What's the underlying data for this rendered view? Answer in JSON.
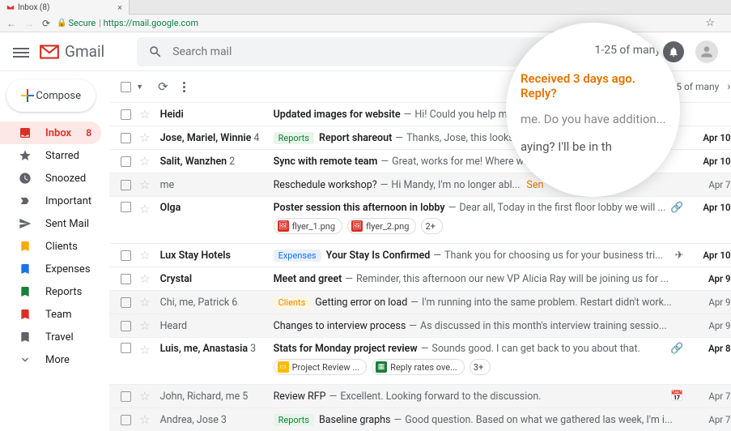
{
  "browser": {
    "tab_title": "Inbox (8)",
    "secure_label": "Secure",
    "url_host": "https://mail.google.com"
  },
  "header": {
    "product": "Gmail",
    "search_placeholder": "Search mail"
  },
  "compose_label": "Compose",
  "sidebar": [
    {
      "label": "Inbox",
      "count": "8"
    },
    {
      "label": "Starred"
    },
    {
      "label": "Snoozed"
    },
    {
      "label": "Important"
    },
    {
      "label": "Sent Mail"
    },
    {
      "label": "Clients"
    },
    {
      "label": "Expenses"
    },
    {
      "label": "Reports"
    },
    {
      "label": "Team"
    },
    {
      "label": "Travel"
    },
    {
      "label": "More"
    }
  ],
  "page_info": "1-25 of many",
  "emails": [
    {
      "sender_html": "Heidi",
      "unread": true,
      "subject": "Updated images for website",
      "snippet": "Hi! Could you help me",
      "date": ""
    },
    {
      "sender_html": "Jose, <b>Mariel</b>, <b>Winnie</b>",
      "count": "4",
      "unread": true,
      "label": "Reports",
      "label_class": "reports",
      "subject": "Report shareout",
      "snippet": "Thanks, Jose, this looks g",
      "date": "Apr 10"
    },
    {
      "sender_html": "<b>Salit</b>, <b>Wanzhen</b>",
      "count": "2",
      "unread": true,
      "subject": "Sync with remote team",
      "snippet": "Great, works for me! Where will",
      "date": "Apr 10"
    },
    {
      "sender_html": "me",
      "unread": false,
      "subject": "Reschedule workshop?",
      "snippet": "Hi Mandy, I'm no longer abl...",
      "action": "Sen",
      "date": "Apr 7"
    },
    {
      "sender_html": "<b>Olga</b>",
      "unread": true,
      "subject": "Poster session this afternoon in lobby",
      "snippet": "Dear all, Today in the first floor lobby we will ...",
      "date": "Apr 10",
      "indicator": "link",
      "attachments": [
        {
          "name": "flyer_1.png",
          "type": "img"
        },
        {
          "name": "flyer_2.png",
          "type": "img"
        },
        {
          "name": "2+",
          "type": "more"
        }
      ]
    },
    {
      "sender_html": "<b>Lux Stay Hotels</b>",
      "unread": true,
      "label": "Expenses",
      "label_class": "expenses",
      "subject": "Your Stay Is Confirmed",
      "snippet": "Thank you for choosing us for your business tri...",
      "date": "Apr 10",
      "indicator": "flight"
    },
    {
      "sender_html": "<b>Crystal</b>",
      "unread": true,
      "subject": "Meet and greet",
      "snippet": "Reminder, this afternoon our new VP Alicia Ray will be joining us for ...",
      "date": "Apr 9"
    },
    {
      "sender_html": "Chi, me, Patrick",
      "count": "6",
      "unread": false,
      "label": "Clients",
      "label_class": "clients",
      "subject": "Getting error on load",
      "snippet": "I'm running into the same problem. Restart didn't work...",
      "date": "Apr 9"
    },
    {
      "sender_html": "Heard",
      "unread": false,
      "subject": "Changes to interview process",
      "snippet": "As discussed in this month's interview training sessio...",
      "date": "Apr 9"
    },
    {
      "sender_html": "Luis, me, <b>Anastasia</b>",
      "count": "3",
      "unread": true,
      "subject": "Stats for Monday project review",
      "snippet": "Sounds good. I can get back to you about that.",
      "date": "Apr 8",
      "indicator": "link",
      "attachments": [
        {
          "name": "Project Review ...",
          "type": "slides"
        },
        {
          "name": "Reply rates ove...",
          "type": "sheets"
        },
        {
          "name": "3+",
          "type": "more"
        }
      ]
    },
    {
      "sender_html": "John, Richard, me",
      "count": "5",
      "unread": false,
      "subject": "Review RFP",
      "snippet": "Excellent. Looking forward to the discussion.",
      "date": "Apr 7",
      "indicator": "cal"
    },
    {
      "sender_html": "Andrea, Jose",
      "count": "3",
      "unread": false,
      "label": "Reports",
      "label_class": "reports",
      "subject": "Baseline graphs",
      "snippet": "Good question. Based on what we gathered las week, I'm i...",
      "date": "Apr 7"
    }
  ],
  "magnifier": {
    "count": "1-25 of many",
    "reply": "Received 3 days ago. Reply?",
    "line1": "me. Do you have addition...",
    "bottom_pre": "aying? I'll be in th"
  }
}
